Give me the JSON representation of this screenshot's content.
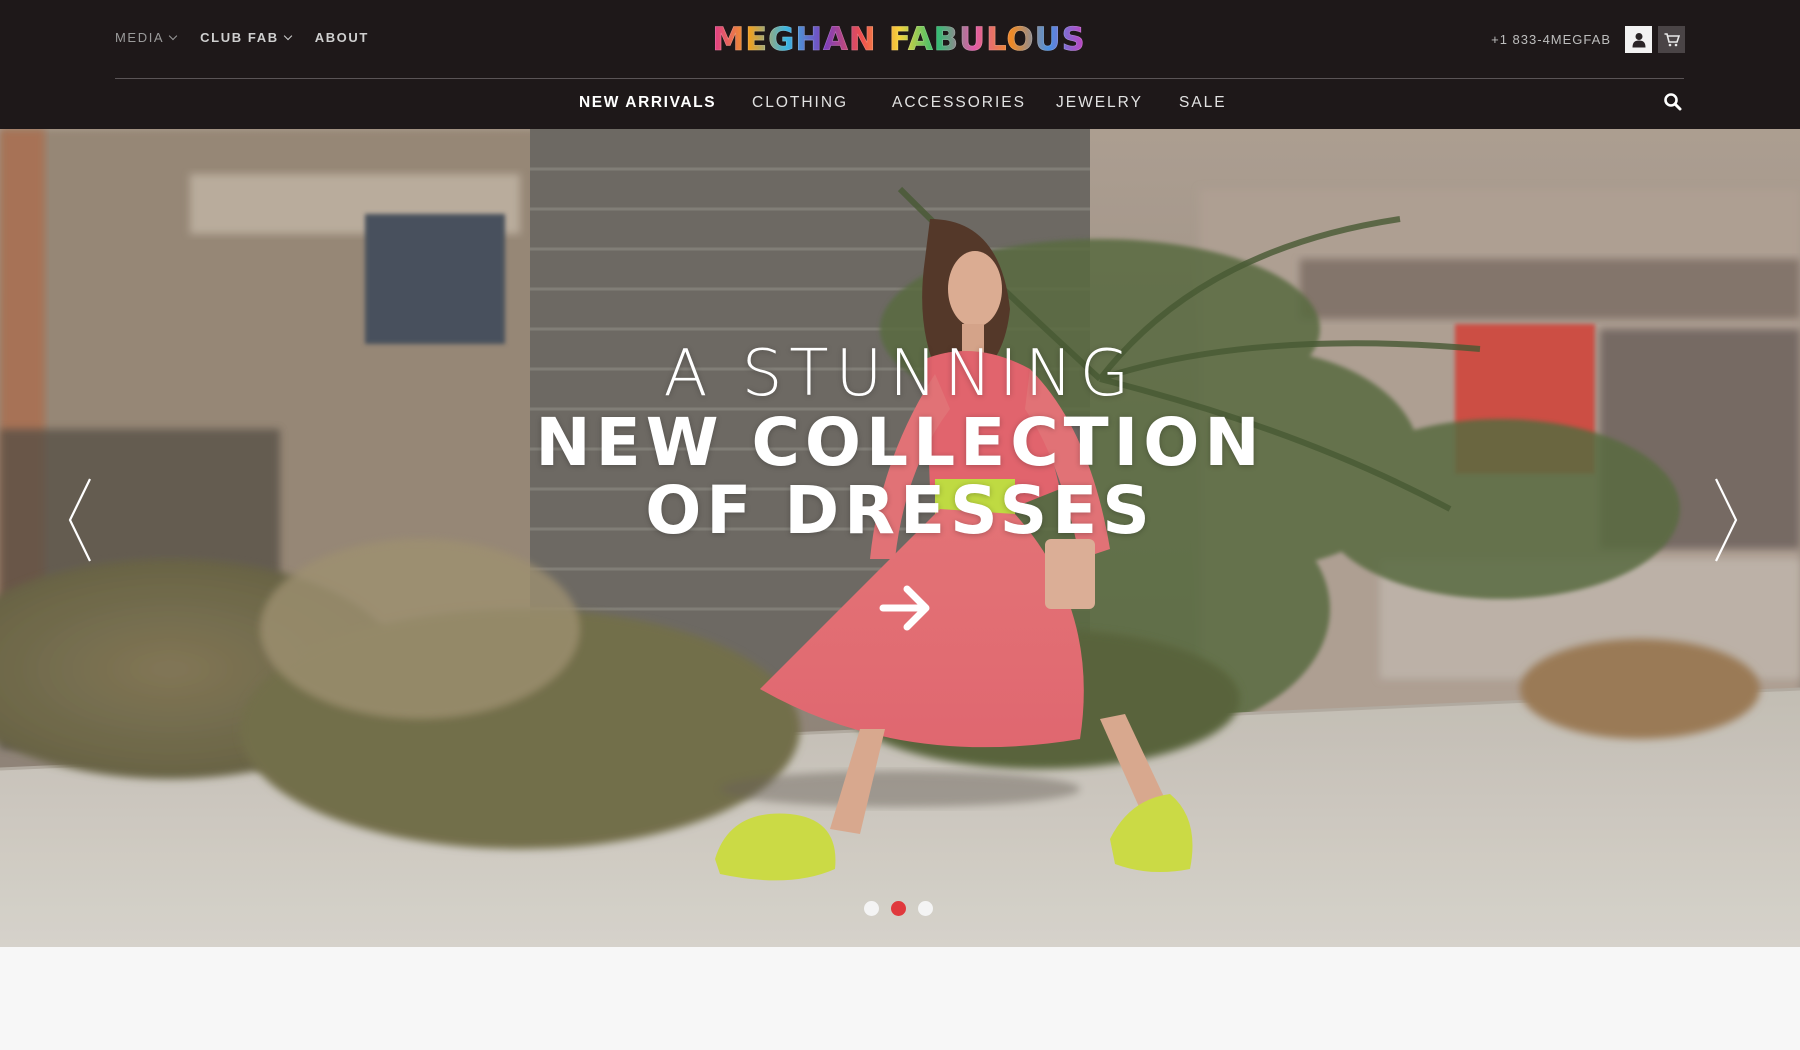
{
  "header": {
    "util_links": [
      {
        "label": "MEDIA",
        "has_dropdown": true
      },
      {
        "label": "CLUB FAB",
        "has_dropdown": true
      },
      {
        "label": "ABOUT",
        "has_dropdown": false
      }
    ],
    "logo_text": "MEGHAN FABULOUS",
    "phone": "+1 833-4MEGFAB",
    "icons": {
      "account": "user-icon",
      "cart": "cart-icon",
      "search": "search-icon"
    }
  },
  "nav": {
    "items": [
      {
        "label": "NEW ARRIVALS",
        "active": true
      },
      {
        "label": "CLOTHING",
        "active": false
      },
      {
        "label": "ACCESSORIES",
        "active": false
      },
      {
        "label": "JEWELRY",
        "active": false
      },
      {
        "label": "SALE",
        "active": false
      }
    ]
  },
  "hero": {
    "line1": "A STUNNING",
    "line2": "NEW COLLECTION",
    "line3": "OF DRESSES",
    "cta_icon": "arrow-right-icon",
    "prev_icon": "chevron-left-icon",
    "next_icon": "chevron-right-icon",
    "slides_total": 3,
    "active_slide": 2
  },
  "colors": {
    "header_bg": "#1e1819",
    "dot_active": "#e0393d",
    "dot_inactive": "#f4f4f4",
    "page_bg": "#f7f7f7"
  }
}
